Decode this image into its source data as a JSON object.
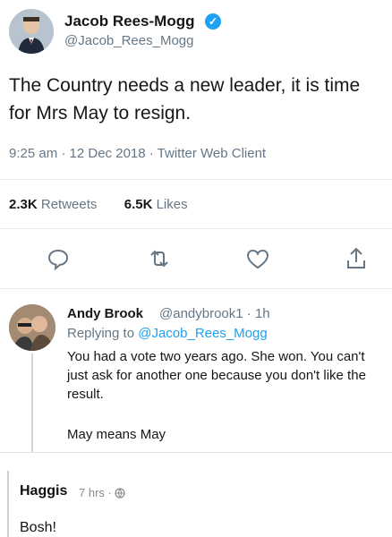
{
  "tweet": {
    "author_name": "Jacob Rees-Mogg",
    "author_handle": "@Jacob_Rees_Mogg",
    "text": "The Country needs a new leader, it is time for Mrs May to resign.",
    "meta": "9:25 am · 12 Dec 2018 · Twitter Web Client",
    "retweets_count": "2.3K",
    "retweets_label": "Retweets",
    "likes_count": "6.5K",
    "likes_label": "Likes",
    "verified_icon": "verified-badge-icon",
    "accent_color": "#1da1f2"
  },
  "actions": [
    "reply-icon",
    "retweet-icon",
    "like-icon",
    "share-icon"
  ],
  "reply": {
    "author_name": "Andy Brook",
    "author_handle": "@andybrook1 · 1h",
    "replying_prefix": "Replying to",
    "replying_handle": "@Jacob_Rees_Mogg",
    "text": "You had a vote two years ago. She won. You can't just ask for another one because you don't like the result.",
    "text2": "May means May"
  },
  "comment": {
    "author": "Haggis",
    "time": "7 hrs ·",
    "globe_icon": "globe-icon",
    "body": "Bosh!"
  }
}
